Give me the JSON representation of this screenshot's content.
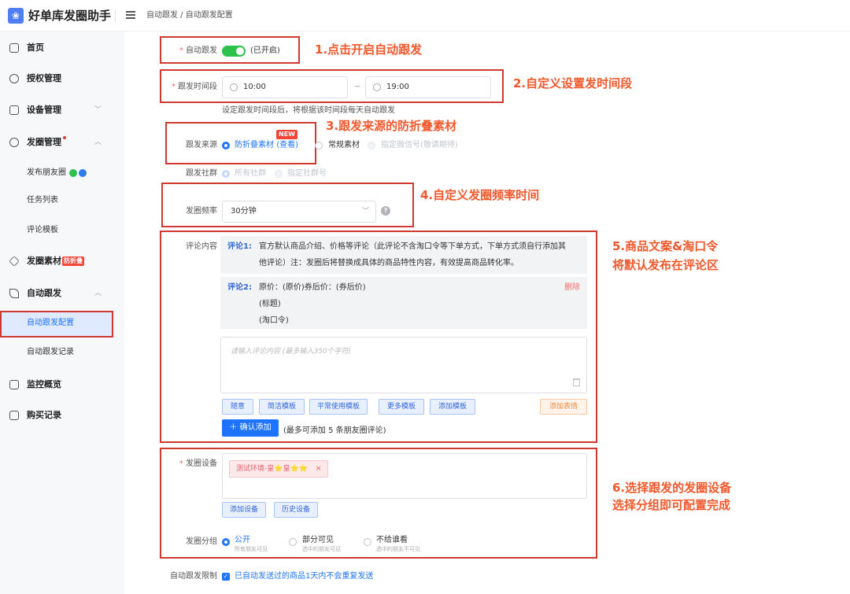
{
  "app": {
    "title": "好单库发圈助手",
    "logo_icon": "logo-icon"
  },
  "header": {
    "breadcrumb": "自动跟发 / 自动跟发配置"
  },
  "sidebar": {
    "items": [
      {
        "label": "首页",
        "icon": "home-icon"
      },
      {
        "label": "授权管理",
        "icon": "user-icon"
      },
      {
        "label": "设备管理",
        "icon": "device-icon",
        "chevron": "﹀"
      },
      {
        "label": "发圈管理",
        "icon": "gear-icon",
        "chevron": "︿"
      },
      {
        "label": "发圈素材",
        "icon": "layers-icon",
        "badge": "防折叠"
      },
      {
        "label": "自动跟发",
        "icon": "send-icon",
        "chevron": "︿"
      },
      {
        "label": "监控概览",
        "icon": "monitor-icon"
      },
      {
        "label": "购买记录",
        "icon": "receipt-icon"
      }
    ],
    "sub_faquan": [
      "发布朋友圈",
      "任务列表",
      "评论模板"
    ],
    "sub_auto": [
      "自动跟发配置",
      "自动跟发记录"
    ]
  },
  "form": {
    "auto_follow": {
      "label": "自动跟发",
      "status": "(已开启)",
      "on": true
    },
    "time_range": {
      "label": "跟发时间段",
      "start": "10:00",
      "sep": "~",
      "end": "19:00",
      "hint": "设定跟发时间段后，将根据该时间段每天自动跟发"
    },
    "source": {
      "label": "跟发来源",
      "new_badge": "NEW",
      "options": [
        {
          "text": "防折叠素材",
          "link": "(查看)",
          "selected": true
        },
        {
          "text": "常规素材",
          "selected": false
        },
        {
          "text": "指定微信号(敬请期待)",
          "selected": false,
          "disabled": true
        }
      ]
    },
    "community": {
      "label": "跟发社群",
      "options": [
        {
          "text": "所有社群",
          "selected": true
        },
        {
          "text": "指定社群号",
          "selected": false
        }
      ]
    },
    "frequency": {
      "label": "发圈频率",
      "value": "30分钟",
      "help": "?"
    },
    "comments": {
      "label": "评论内容",
      "items": [
        {
          "title": "评论1:",
          "lines": [
            "官方默认商品介绍、价格等评论（此评论不含淘口令等下单方式，下单方式须自行添加其",
            "他评论）注：发圈后将替换成具体的商品特性内容，有效提高商品转化率。"
          ]
        },
        {
          "title": "评论2:",
          "lines": [
            "原价：(原价)券后价：(券后价)",
            "(标题)",
            "(淘口令)"
          ],
          "delete": "删除"
        }
      ],
      "placeholder": "请输入评论内容 (最多输入350个字符)",
      "buttons": [
        "随意",
        "简洁模板",
        "平常使用模板",
        "更多模板",
        "添加模板"
      ],
      "emoji": "添加表情",
      "confirm": "＋ 确认添加",
      "confirm_hint": "(最多可添加 5 条朋友圈评论)"
    },
    "device": {
      "label": "发圈设备",
      "tag": "测试环境-皇⭐皇⭐⭐",
      "tag_close": "×",
      "buttons": [
        "添加设备",
        "历史设备"
      ]
    },
    "group": {
      "label": "发圈分组",
      "options": [
        {
          "text": "公开",
          "sub": "所有朋友可见",
          "selected": true
        },
        {
          "text": "部分可见",
          "sub": "选中的朋友可见",
          "selected": false
        },
        {
          "text": "不给谁看",
          "sub": "选中的朋友不可见",
          "selected": false
        }
      ]
    },
    "limit": {
      "label": "自动跟发限制",
      "text": "已自动发送过的商品1天内不会重复发送",
      "checked": true
    }
  },
  "annotations": [
    "1.点击开启自动跟发",
    "2.自定义设置发时间段",
    "3.跟发来源的防折叠素材",
    "4.自定义发圈频率时间",
    "5.商品文案&淘口令",
    "将默认发布在评论区",
    "6.选择跟发的发圈设备",
    "选择分组即可配置完成"
  ],
  "colors": {
    "primary": "#1f74ff",
    "switch_on": "#2ec24d",
    "annotation": "#f2582b",
    "highlight_box": "#d0392f"
  }
}
